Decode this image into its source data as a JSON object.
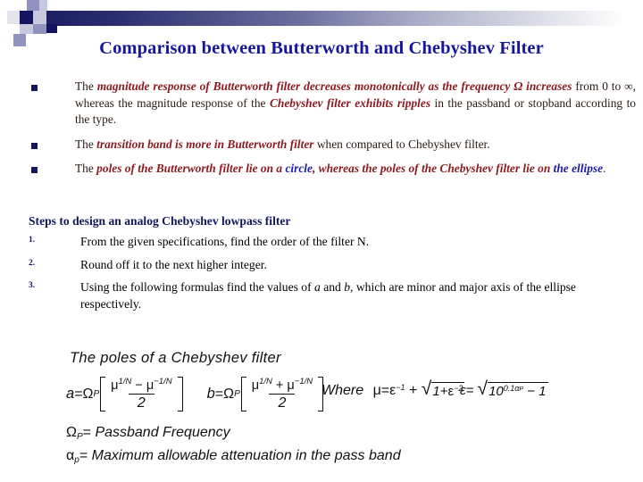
{
  "slide": {
    "title": "Comparison between Butterworth and Chebyshev Filter",
    "decoration": {
      "name": "gradient-bar-with-squares",
      "gradient_from": "#1b1f63",
      "gradient_to": "#ffffff",
      "square_dark": "#13165e",
      "square_mid": "#8f93bd",
      "square_light": "#c7c9de"
    },
    "colors": {
      "title": "#17179c",
      "bullet_text": "#7b1a22",
      "emphasis": "#8b1a1f",
      "blue_emphasis": "#1c1ca8",
      "heading": "#13165e",
      "body": "#000000"
    }
  },
  "bullets": [
    {
      "marker": "square-bullet",
      "parts": [
        {
          "text": "The ",
          "style": "plain"
        },
        {
          "text": "magnitude response of Butterworth filter decreases monotonically as the frequency Ω increases",
          "style": "em"
        },
        {
          "text": " from 0 to ∞, whereas the magnitude response of the ",
          "style": "plain"
        },
        {
          "text": "Chebyshev filter exhibits ripples",
          "style": "em"
        },
        {
          "text": " in the passband or stopband according to the type.",
          "style": "plain"
        }
      ]
    },
    {
      "marker": "square-bullet",
      "parts": [
        {
          "text": "The ",
          "style": "plain"
        },
        {
          "text": "transition band is more in Butterworth filter",
          "style": "em"
        },
        {
          "text": " when compared to Chebyshev filter.",
          "style": "plain"
        }
      ]
    },
    {
      "marker": "square-bullet",
      "parts": [
        {
          "text": "The ",
          "style": "plain"
        },
        {
          "text": "poles of the Butterworth filter lie on a ",
          "style": "em"
        },
        {
          "text": "circle",
          "style": "blue-em"
        },
        {
          "text": ", whereas the poles of the Chebyshev filter lie on ",
          "style": "em"
        },
        {
          "text": "the ellipse",
          "style": "blue-em"
        },
        {
          "text": ".",
          "style": "plain"
        }
      ]
    }
  ],
  "steps_section": {
    "heading": "Steps to design an analog Chebyshev lowpass filter",
    "items": [
      {
        "number": "1.",
        "text": "From the given specifications, find the order of the filter N."
      },
      {
        "number": "2.",
        "text": "Round off it to the next higher integer."
      },
      {
        "number": "3.",
        "text": "Using the following formulas find the values of a and b, which are minor and major axis of the ellipse respectively."
      }
    ]
  },
  "formula_block": {
    "caption": "The poles of a Chebyshev filter",
    "equation_a": {
      "lhs": "a",
      "eq": "=",
      "omega": "Ω",
      "omega_sub": "P",
      "numerator_left": "μ",
      "numerator_left_exp": "1/N",
      "operator": "−",
      "numerator_right": "μ",
      "numerator_right_exp": "−1/N",
      "denominator": "2"
    },
    "equation_b": {
      "lhs": "b",
      "eq": "=",
      "omega": "Ω",
      "omega_sub": "P",
      "numerator_left": "μ",
      "numerator_left_exp": "1/N",
      "operator": "+",
      "numerator_right": "μ",
      "numerator_right_exp": "−1/N",
      "denominator": "2"
    },
    "where_label": "Where",
    "mu_definition": {
      "lhs": "μ",
      "eq": "=",
      "eps": "ε",
      "eps_exp": "−1",
      "plus": "+",
      "radicand_a": "1+",
      "radicand_eps": "ε",
      "radicand_eps_exp": "−2"
    },
    "eps_definition": {
      "lhs": "ε",
      "eq": "=",
      "base": "10",
      "exponent": "0.1α",
      "exponent_sub": "P",
      "minus_one": "− 1"
    },
    "legend": [
      {
        "symbol": "Ω",
        "sub": "P",
        "eq": "=",
        "text": "Passband Frequency"
      },
      {
        "symbol": "α",
        "sub": "p",
        "eq": "=",
        "text": "Maximum allowable attenuation in the pass band"
      }
    ]
  }
}
